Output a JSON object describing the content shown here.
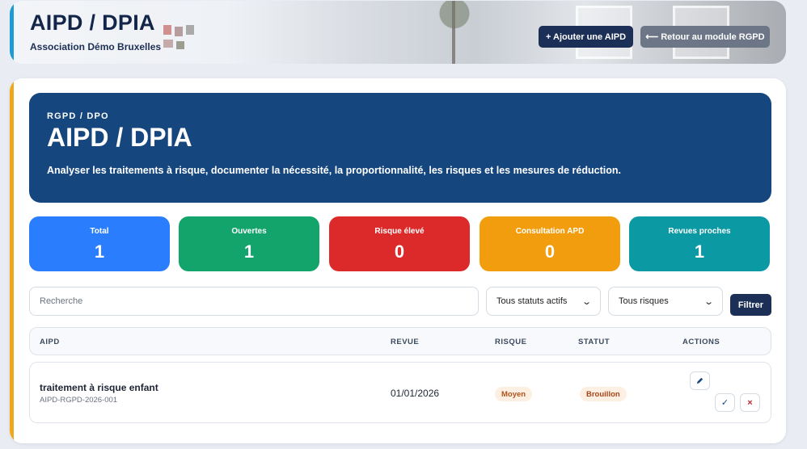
{
  "header": {
    "title": "AIPD / DPIA",
    "organization": "Association Démo Bruxelles",
    "add_button": "+ Ajouter une AIPD",
    "back_button": "⟵ Retour au module RGPD"
  },
  "hero": {
    "eyebrow": "RGPD / DPO",
    "heading": "AIPD / DPIA",
    "description": "Analyser les traitements à risque, documenter la nécessité, la proportionnalité, les risques et les mesures de réduction."
  },
  "stats": [
    {
      "label": "Total",
      "value": "1",
      "color": "#2a7dfc"
    },
    {
      "label": "Ouvertes",
      "value": "1",
      "color": "#12a46b"
    },
    {
      "label": "Risque élevé",
      "value": "0",
      "color": "#dc2a2a"
    },
    {
      "label": "Consultation APD",
      "value": "0",
      "color": "#f29d0e"
    },
    {
      "label": "Revues proches",
      "value": "1",
      "color": "#0b99a4"
    }
  ],
  "filters": {
    "search_placeholder": "Recherche",
    "status_select": "Tous statuts actifs",
    "risk_select": "Tous risques",
    "filter_button": "Filtrer"
  },
  "table": {
    "headers": [
      "AIPD",
      "REVUE",
      "RISQUE",
      "STATUT",
      "ACTIONS"
    ],
    "rows": [
      {
        "name": "traitement à risque enfant",
        "reference": "AIPD-RGPD-2026-001",
        "review_date": "01/01/2026",
        "risk": "Moyen",
        "status": "Brouillon",
        "actions": [
          "edit-icon",
          "check-icon",
          "close-icon"
        ]
      }
    ]
  }
}
